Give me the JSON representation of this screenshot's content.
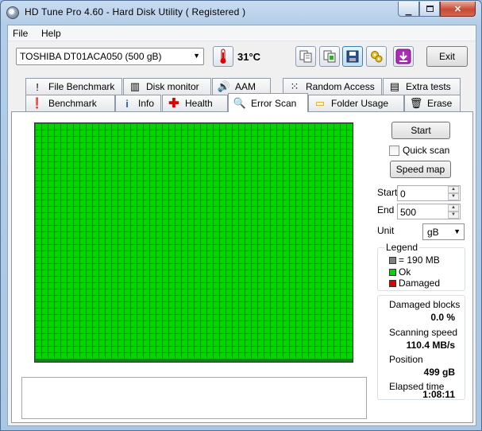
{
  "window": {
    "title": "HD Tune Pro 4.60 - Hard Disk Utility (  Registered )"
  },
  "menu": {
    "file": "File",
    "help": "Help"
  },
  "toolbar": {
    "drive": "TOSHIBA DT01ACA050 (500 gB)",
    "temperature": "31°C",
    "exit_label": "Exit",
    "icons": [
      "thermometer-icon",
      "copy-icon",
      "copy-screenshot-icon",
      "save-icon",
      "settings-icon",
      "download-icon"
    ]
  },
  "tabs_top": [
    "File Benchmark",
    "Disk monitor",
    "AAM",
    "Random Access",
    "Extra tests"
  ],
  "tabs_bottom": [
    "Benchmark",
    "Info",
    "Health",
    "Error Scan",
    "Folder Usage",
    "Erase"
  ],
  "active_tab": "Error Scan",
  "controls": {
    "start_button": "Start",
    "quick_scan_label": "Quick scan",
    "speed_map_button": "Speed map",
    "start_label": "Start",
    "start_value": "0",
    "end_label": "End",
    "end_value": "500",
    "unit_label": "Unit",
    "unit_value": "gB"
  },
  "legend": {
    "title": "Legend",
    "items": [
      {
        "label": "= 190 MB",
        "color": "#808080"
      },
      {
        "label": "Ok",
        "color": "#00d600"
      },
      {
        "label": "Damaged",
        "color": "#e00000"
      }
    ]
  },
  "stats": {
    "damaged_label": "Damaged blocks",
    "damaged_value": "0.0 %",
    "speed_label": "Scanning speed",
    "speed_value": "110.4 MB/s",
    "position_label": "Position",
    "position_value": "499 gB",
    "elapsed_label": "Elapsed time",
    "elapsed_value": "1:08:11"
  },
  "scan_grid": {
    "ok_color": "#00d600",
    "line_color": "#1f7f1f"
  }
}
